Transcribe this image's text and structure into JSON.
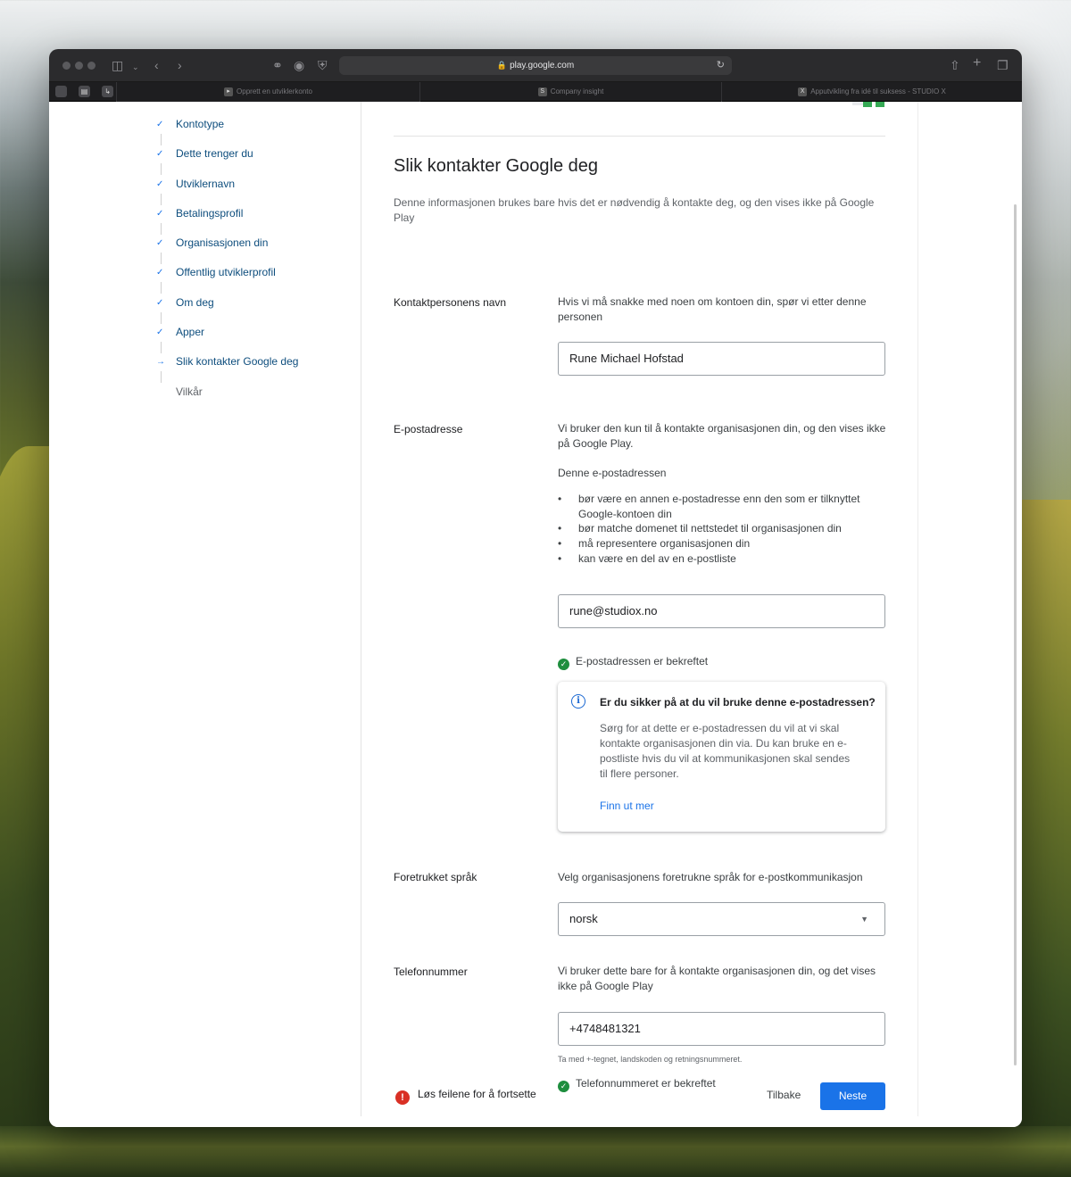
{
  "browser": {
    "url": "play.google.com",
    "tabs": [
      {
        "label": "Opprett en utviklerkonto",
        "active": true
      },
      {
        "label": "Company insight",
        "favicon": "S",
        "active": false
      },
      {
        "label": "Apputvikling fra idé til suksess - STUDIO X",
        "favicon": "X",
        "active": false
      }
    ]
  },
  "sidebar": {
    "steps": [
      {
        "label": "Kontotype",
        "status": "done"
      },
      {
        "label": "Dette trenger du",
        "status": "done"
      },
      {
        "label": "Utviklernavn",
        "status": "done"
      },
      {
        "label": "Betalingsprofil",
        "status": "done"
      },
      {
        "label": "Organisasjonen din",
        "status": "done"
      },
      {
        "label": "Offentlig utviklerprofil",
        "status": "done"
      },
      {
        "label": "Om deg",
        "status": "done"
      },
      {
        "label": "Apper",
        "status": "done"
      },
      {
        "label": "Slik kontakter Google deg",
        "status": "current"
      },
      {
        "label": "Vilkår",
        "status": "pending"
      }
    ]
  },
  "form": {
    "title": "Slik kontakter Google deg",
    "intro": "Denne informasjonen brukes bare hvis det er nødvendig å kontakte deg, og den vises ikke på Google Play",
    "contact": {
      "label": "Kontaktpersonens navn",
      "description": "Hvis vi må snakke med noen om kontoen din, spør vi etter denne personen",
      "value": "Rune Michael Hofstad"
    },
    "email": {
      "label": "E-postadresse",
      "description": "Vi bruker den kun til å kontakte organisasjonen din, og den vises ikke på Google Play.",
      "list_intro": "Denne e-postadressen",
      "requirements": [
        "bør være en annen e-postadresse enn den som er tilknyttet Google-kontoen din",
        "bør matche domenet til nettstedet til organisasjonen din",
        "må representere organisasjonen din",
        "kan være en del av en e-postliste"
      ],
      "value": "rune@studiox.no",
      "verified": "E-postadressen er bekreftet",
      "info": {
        "title": "Er du sikker på at du vil bruke denne e-postadressen?",
        "body": "Sørg for at dette er e-postadressen du vil at vi skal kontakte organisasjonen din via. Du kan bruke en e-postliste hvis du vil at kommunikasjonen skal sendes til flere personer.",
        "link": "Finn ut mer"
      }
    },
    "language": {
      "label": "Foretrukket språk",
      "description": "Velg organisasjonens foretrukne språk for e-postkommunikasjon",
      "selected": "norsk"
    },
    "phone": {
      "label": "Telefonnummer",
      "description": "Vi bruker dette bare for å kontakte organisasjonen din, og det vises ikke på Google Play",
      "value": "+4748481321",
      "hint": "Ta med +-tegnet, landskoden og retningsnummeret.",
      "verified": "Telefonnummeret er bekreftet"
    }
  },
  "footer": {
    "error": "Løs feilene for å fortsette",
    "back": "Tilbake",
    "next": "Neste"
  },
  "colors": {
    "accent": "#1a73e8",
    "success": "#1e8e3e",
    "error": "#d93025"
  }
}
